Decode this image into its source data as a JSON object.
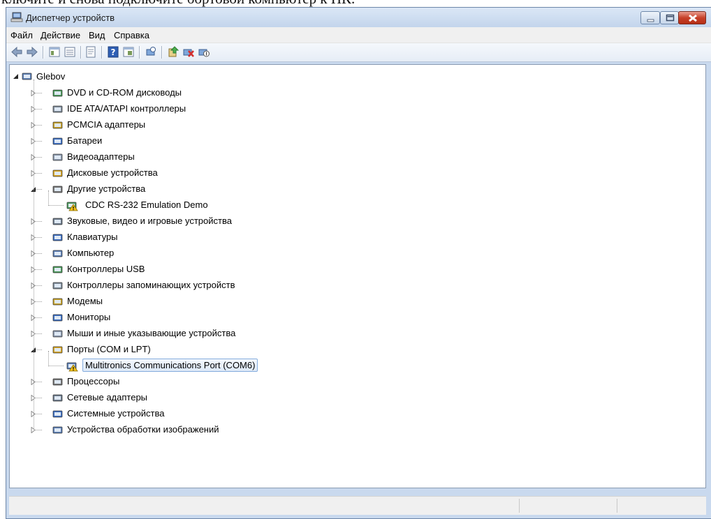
{
  "doc_text": "ключите и снова подключите бортовой компьютер к ПК.",
  "window": {
    "title": "Диспетчер устройств"
  },
  "menu": [
    "Файл",
    "Действие",
    "Вид",
    "Справка"
  ],
  "toolbar_icons": [
    "back-icon",
    "forward-icon",
    "show-hide-tree-icon",
    "properties-icon",
    "help-icon",
    "view-icon",
    "scan-hardware-icon",
    "update-driver-icon",
    "uninstall-icon",
    "disable-icon"
  ],
  "tree": {
    "root": "Glebov",
    "items": [
      {
        "label": "DVD и CD-ROM дисководы",
        "icon": "dvd-drive-icon",
        "expanded": false
      },
      {
        "label": "IDE ATA/ATAPI контроллеры",
        "icon": "ide-controller-icon",
        "expanded": false
      },
      {
        "label": "PCMCIA адаптеры",
        "icon": "pcmcia-icon",
        "expanded": false
      },
      {
        "label": "Батареи",
        "icon": "battery-icon",
        "expanded": false
      },
      {
        "label": "Видеоадаптеры",
        "icon": "display-adapter-icon",
        "expanded": false
      },
      {
        "label": "Дисковые устройства",
        "icon": "disk-drive-icon",
        "expanded": false
      },
      {
        "label": "Другие устройства",
        "icon": "unknown-device-icon",
        "expanded": true,
        "children": [
          {
            "label": "CDC RS-232 Emulation Demo",
            "icon": "warning-device-icon"
          }
        ]
      },
      {
        "label": "Звуковые, видео и игровые устройства",
        "icon": "speaker-icon",
        "expanded": false
      },
      {
        "label": "Клавиатуры",
        "icon": "keyboard-icon",
        "expanded": false
      },
      {
        "label": "Компьютер",
        "icon": "computer-icon",
        "expanded": false
      },
      {
        "label": "Контроллеры USB",
        "icon": "usb-icon",
        "expanded": false
      },
      {
        "label": "Контроллеры запоминающих устройств",
        "icon": "storage-controller-icon",
        "expanded": false
      },
      {
        "label": "Модемы",
        "icon": "modem-icon",
        "expanded": false
      },
      {
        "label": "Мониторы",
        "icon": "monitor-icon",
        "expanded": false
      },
      {
        "label": "Мыши и иные указывающие устройства",
        "icon": "mouse-icon",
        "expanded": false
      },
      {
        "label": "Порты (COM и LPT)",
        "icon": "port-icon",
        "expanded": true,
        "children": [
          {
            "label": "Multitronics Communications Port (COM6)",
            "icon": "warning-port-icon",
            "selected": true
          }
        ]
      },
      {
        "label": "Процессоры",
        "icon": "processor-icon",
        "expanded": false
      },
      {
        "label": "Сетевые адаптеры",
        "icon": "network-adapter-icon",
        "expanded": false
      },
      {
        "label": "Системные устройства",
        "icon": "system-device-icon",
        "expanded": false
      },
      {
        "label": "Устройства обработки изображений",
        "icon": "imaging-device-icon",
        "expanded": false
      }
    ]
  },
  "colors": {
    "selection_border": "#84acdd",
    "warning": "#f3c21b",
    "title_bg": "#c9d9ee"
  }
}
